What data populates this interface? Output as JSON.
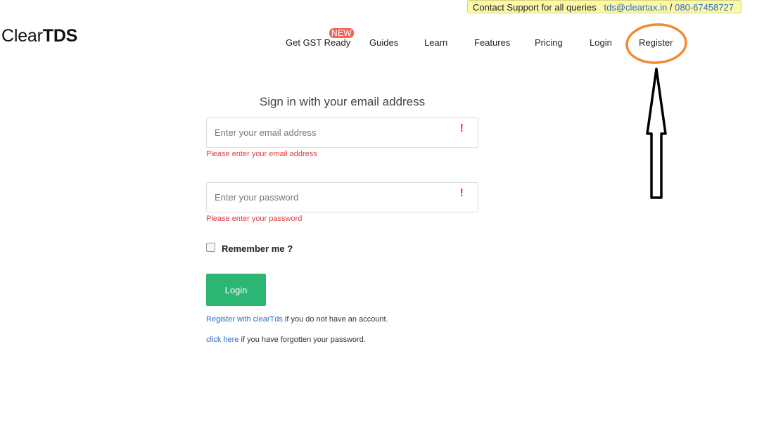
{
  "support": {
    "text": "Contact Support for all queries",
    "email": "tds@cleartax.in",
    "separator": "/",
    "phone": "080-67458727"
  },
  "logo": {
    "prefix": "Clear",
    "bold": "TDS"
  },
  "nav": {
    "badge": "NEW",
    "items": [
      "Get GST Ready",
      "Guides",
      "Learn",
      "Features",
      "Pricing",
      "Login",
      "Register"
    ]
  },
  "form": {
    "title": "Sign in with your email address",
    "email_placeholder": "Enter your email address",
    "email_error": "Please enter your email address",
    "password_placeholder": "Enter your password",
    "password_error": "Please enter your password",
    "warning_mark": "!",
    "remember_label": "Remember me ?",
    "login_button": "Login",
    "register_link": "Register with clearTds",
    "register_suffix": "if you do not have an account.",
    "forgot_link": "click here",
    "forgot_suffix": "if you have forgotten your password."
  },
  "annotation_color": "#f28a2e",
  "colors": {
    "accent_green": "#2bb673",
    "error_red": "#e0383d",
    "link_blue": "#2b6cc4",
    "support_bg": "#fbf8a8"
  }
}
